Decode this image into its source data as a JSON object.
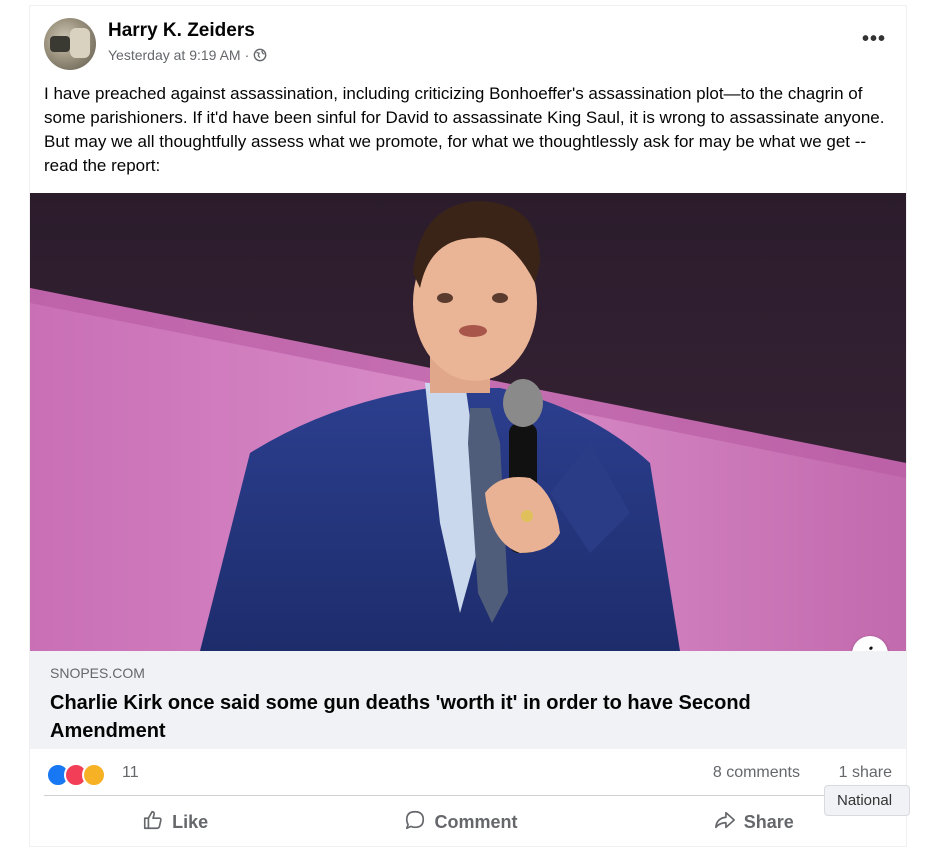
{
  "post": {
    "author": "Harry K. Zeiders",
    "timestamp": "Yesterday at 9:19 AM",
    "separator": "·",
    "audience_icon": "globe-icon",
    "more_label": "•••",
    "text": "I have preached against assassination, including criticizing Bonhoeffer's assassination plot—to the chagrin of some parishioners. If it'd have been sinful for David to assassinate King Saul, it is wrong to assassinate anyone. But may we all thoughtfully assess what we promote, for what we thoughtlessly ask for may be what we get -- read the report:"
  },
  "link": {
    "domain": "SNOPES.COM",
    "title": "Charlie Kirk once said some gun deaths 'worth it' in order to have Second Amendment",
    "info_label": "i"
  },
  "stats": {
    "reaction_icons": [
      "like-reaction-icon",
      "love-reaction-icon",
      "care-reaction-icon"
    ],
    "reactions": "11",
    "comments": "8 comments",
    "shares": "1 share"
  },
  "actions": {
    "like": "Like",
    "comment": "Comment",
    "share": "Share"
  },
  "tooltip": {
    "text": "National"
  },
  "colors": {
    "like_blue": "#1877f2",
    "love_red": "#f33e58",
    "care_yellow": "#f7b125",
    "link_bg": "#f0f2f5",
    "secondary_text": "#65676b"
  }
}
